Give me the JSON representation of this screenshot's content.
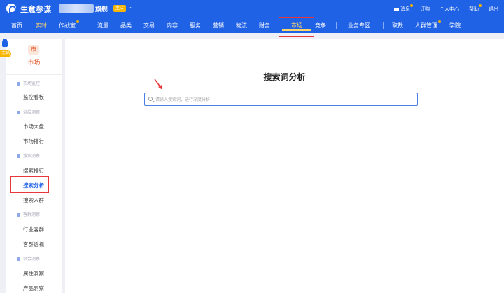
{
  "header": {
    "brand": "生意参谋",
    "shop_name": "旗舰",
    "shop_badge": "主店",
    "caret": "⌄",
    "links": {
      "messages": "消息",
      "subscribe": "订购",
      "profile": "个人中心",
      "help": "帮助",
      "logout": "退出"
    }
  },
  "nav": {
    "home": "首页",
    "realtime": "实时",
    "battle": "作战室",
    "traffic": "流量",
    "category": "品类",
    "trade": "交易",
    "content": "内容",
    "service": "服务",
    "marketing": "营销",
    "logistics": "物流",
    "finance": "财务",
    "market": "市场",
    "competition": "竞争",
    "business": "业务专区",
    "data": "取数",
    "crowd": "人群管理",
    "academy": "学院"
  },
  "sidebar": {
    "head_icon": "市",
    "head_label": "市场",
    "rocket_tag": "市场",
    "groups": {
      "monitor": "市场监控",
      "insight": "供给洞察",
      "search": "搜索洞察",
      "customer": "客群洞察",
      "opportunity": "机会洞察"
    },
    "links": {
      "dashboard": "监控看板",
      "market_overview": "市场大盘",
      "market_rank": "市场排行",
      "search_rank": "搜索排行",
      "search_analysis": "搜索分析",
      "search_crowd": "搜索人群",
      "industry_crowd": "行业客群",
      "crowd_perspective": "客群透视",
      "attribute_insight": "属性洞察",
      "product_insight": "产品洞察"
    }
  },
  "main": {
    "title": "搜索词分析",
    "search_placeholder": "请输入搜索词，进行深度分析"
  },
  "colors": {
    "primary": "#2062e6",
    "accent": "#ffd56b",
    "highlight_box": "#e8363a",
    "market_orange": "#e55c2d"
  }
}
